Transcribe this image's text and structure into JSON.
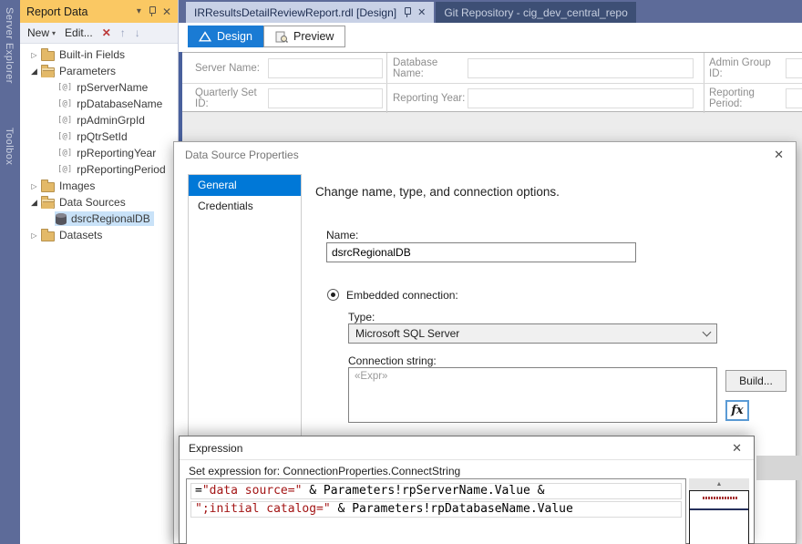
{
  "colors": {
    "frame_slate": "#5d6b99",
    "panel_title_gold": "#fac863",
    "active_doc_tab": "#c8d1e6",
    "inactive_doc_tab": "#3d4f75",
    "design_tab_blue": "#1a7bd4",
    "nav_selected_blue": "#0078d7",
    "tree_selection": "#c9e2f8",
    "code_string_red": "#a31515"
  },
  "glyphs": {
    "dropdown": "▾",
    "close": "✕",
    "red_x": "✕",
    "up_arrow": "↑",
    "down_arrow": "↓",
    "collapsed": "▷",
    "expanded": "◢",
    "scroll_up": "▲",
    "param_icon": "[@]",
    "expr_placeholder": "«Expr»"
  },
  "activity_bar": {
    "items": [
      {
        "label": "Server Explorer"
      },
      {
        "label": "Toolbox"
      }
    ]
  },
  "report_data_panel": {
    "title": "Report Data",
    "toolbar": {
      "new_label": "New",
      "edit_label": "Edit..."
    },
    "tree": [
      {
        "label": "Built-in Fields"
      },
      {
        "label": "Parameters"
      },
      {
        "label": "rpServerName"
      },
      {
        "label": "rpDatabaseName"
      },
      {
        "label": "rpAdminGrpId"
      },
      {
        "label": "rpQtrSetId"
      },
      {
        "label": "rpReportingYear"
      },
      {
        "label": "rpReportingPeriod"
      },
      {
        "label": "Images"
      },
      {
        "label": "Data Sources"
      },
      {
        "label": "dsrcRegionalDB"
      },
      {
        "label": "Datasets"
      }
    ]
  },
  "document_tabs": [
    {
      "label": "IRResultsDetailReviewReport.rdl [Design]",
      "active": true
    },
    {
      "label": "Git Repository - cig_dev_central_repo",
      "active": false
    }
  ],
  "view_tabs": [
    {
      "label": "Design",
      "active": true
    },
    {
      "label": "Preview",
      "active": false
    }
  ],
  "parameters_prompt": {
    "fields": [
      {
        "label": "Server Name:"
      },
      {
        "label": "Database Name:"
      },
      {
        "label": "Admin Group ID:"
      },
      {
        "label": "Quarterly Set ID:"
      },
      {
        "label": "Reporting Year:"
      },
      {
        "label": "Reporting Period:"
      }
    ]
  },
  "data_source_dialog": {
    "title": "Data Source Properties",
    "nav": [
      {
        "label": "General",
        "selected": true
      },
      {
        "label": "Credentials",
        "selected": false
      }
    ],
    "heading": "Change name, type, and connection options.",
    "name_label": "Name:",
    "name_value": "dsrcRegionalDB",
    "embedded_radio_label": "Embedded connection:",
    "type_label": "Type:",
    "type_value": "Microsoft SQL Server",
    "connection_label": "Connection string:",
    "connection_value": "«Expr»",
    "build_button": "Build...",
    "fx_button": "fx"
  },
  "expression_dialog": {
    "title": "Expression",
    "set_expression_label": "Set expression for: ConnectionProperties.ConnectString",
    "code_lines": [
      {
        "tokens": [
          {
            "t": "=",
            "c": "plain"
          },
          {
            "t": "\"data source=\"",
            "c": "string"
          },
          {
            "t": " & Parameters!rpServerName.Value &",
            "c": "plain"
          }
        ]
      },
      {
        "tokens": [
          {
            "t": "\";initial catalog=\"",
            "c": "string"
          },
          {
            "t": " & Parameters!rpDatabaseName.Value",
            "c": "plain"
          }
        ]
      }
    ]
  }
}
